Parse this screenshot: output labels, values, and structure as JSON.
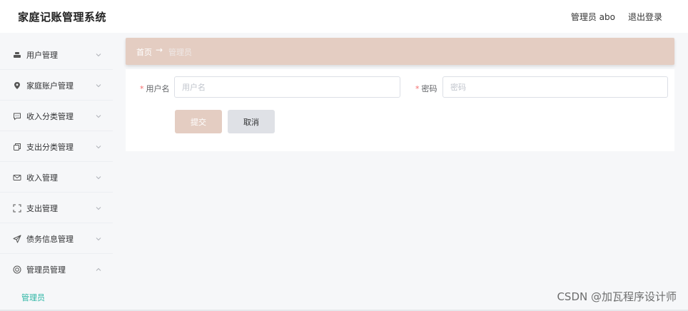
{
  "header": {
    "title": "家庭记账管理系统",
    "user_info": "管理员 abo",
    "logout_label": "退出登录"
  },
  "sidebar": {
    "items": [
      {
        "label": "用户管理",
        "icon": "user-group-icon",
        "expanded": false
      },
      {
        "label": "家庭账户管理",
        "icon": "location-pin-icon",
        "expanded": false
      },
      {
        "label": "收入分类管理",
        "icon": "chat-icon",
        "expanded": false
      },
      {
        "label": "支出分类管理",
        "icon": "copy-icon",
        "expanded": false
      },
      {
        "label": "收入管理",
        "icon": "mail-icon",
        "expanded": false
      },
      {
        "label": "支出管理",
        "icon": "fullscreen-icon",
        "expanded": false
      },
      {
        "label": "债务信息管理",
        "icon": "send-icon",
        "expanded": false
      },
      {
        "label": "管理员管理",
        "icon": "help-circle-icon",
        "expanded": true
      }
    ],
    "submenu": {
      "label": "管理员"
    }
  },
  "breadcrumb": {
    "home": "首页",
    "separator": "→",
    "current": "管理员"
  },
  "form": {
    "username": {
      "label": "用户名",
      "placeholder": "用户名",
      "value": ""
    },
    "password": {
      "label": "密码",
      "placeholder": "密码",
      "value": ""
    },
    "submit_label": "提交",
    "cancel_label": "取消"
  },
  "watermark": "CSDN @加瓦程序设计师",
  "colors": {
    "accent": "#e4cdc2",
    "active_menu": "#2bb5a4",
    "required": "#f56c6c",
    "background": "#f6f7f9"
  }
}
